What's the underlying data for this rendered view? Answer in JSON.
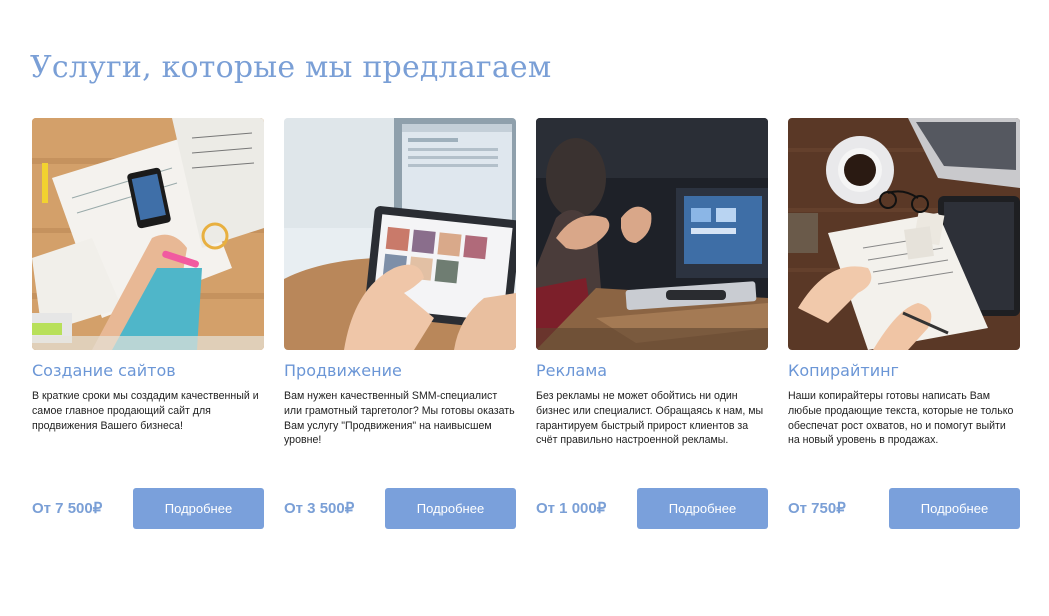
{
  "section": {
    "title": "Услуги, которые мы предлагаем"
  },
  "colors": {
    "accent": "#7aa0db",
    "title": "#7a9fd6"
  },
  "cards": [
    {
      "title": "Создание сайтов",
      "text": "В краткие сроки мы создадим качественный и самое главное продающий сайт для продвижения Вашего бизнеса!",
      "price": "От 7 500₽",
      "button": "Подробнее",
      "image": "photo-web-design-desk"
    },
    {
      "title": "Продвижение",
      "text": "Вам нужен качественный SMM-специалист или грамотный таргетолог? Мы готовы оказать Вам услугу \"Продвижения\" на наивысшем уровне!",
      "price": "От 3 500₽",
      "button": "Подробнее",
      "image": "photo-tablet-in-hands"
    },
    {
      "title": "Реклама",
      "text": "Без рекламы не может обойтись ни один бизнес или специалист. Обращаясь к нам, мы гарантируем быстрый прирост клиентов за счёт правильно настроенной рекламы.",
      "price": "От 1 000₽",
      "button": "Подробнее",
      "image": "photo-meeting-laptop"
    },
    {
      "title": "Копирайтинг",
      "text": "Наши копирайтеры готовы написать Вам любые продающие текста, которые не только обеспечат рост охватов, но и помогут выйти на новый уровень в продажах.",
      "price": "От 750₽",
      "button": "Подробнее",
      "image": "photo-writing-coffee"
    }
  ]
}
